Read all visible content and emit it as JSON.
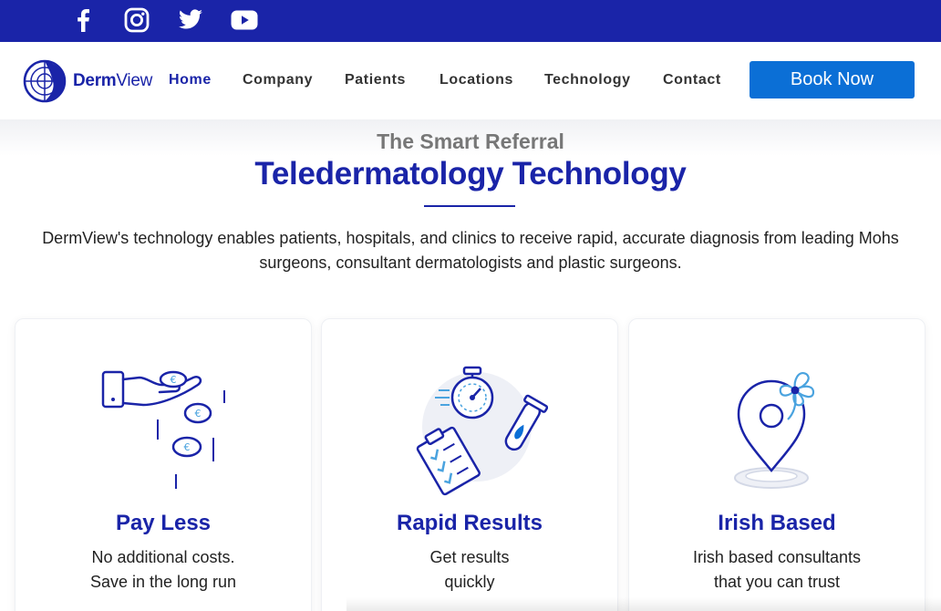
{
  "social": [
    {
      "icon": "facebook-icon"
    },
    {
      "icon": "instagram-icon"
    },
    {
      "icon": "twitter-icon"
    },
    {
      "icon": "youtube-icon"
    }
  ],
  "brand": {
    "name_bold": "Derm",
    "name_light": "View"
  },
  "nav": {
    "items": [
      "Home",
      "Company",
      "Patients",
      "Locations",
      "Technology",
      "Contact"
    ],
    "active": "Home",
    "cta": "Book Now"
  },
  "hero": {
    "kicker": "The Smart Referral",
    "title": "Teledermatology Technology",
    "intro": "DermView's technology enables patients, hospitals, and clinics to receive rapid, accurate diagnosis from leading Mohs surgeons, consultant dermatologists and plastic surgeons."
  },
  "features": [
    {
      "icon": "hand-coins-icon",
      "title": "Pay Less",
      "line1": "No additional costs.",
      "line2": "Save in the long run"
    },
    {
      "icon": "stopwatch-test-tube-icon",
      "title": "Rapid Results",
      "line1": "Get results",
      "line2": "quickly"
    },
    {
      "icon": "shamrock-location-pin-icon",
      "title": "Irish Based",
      "line1": "Irish based consultants",
      "line2": "that you can trust"
    }
  ],
  "colors": {
    "brand_blue": "#1a24a8",
    "button_blue": "#0b6fd6",
    "accent_light_blue": "#4aa3df"
  }
}
